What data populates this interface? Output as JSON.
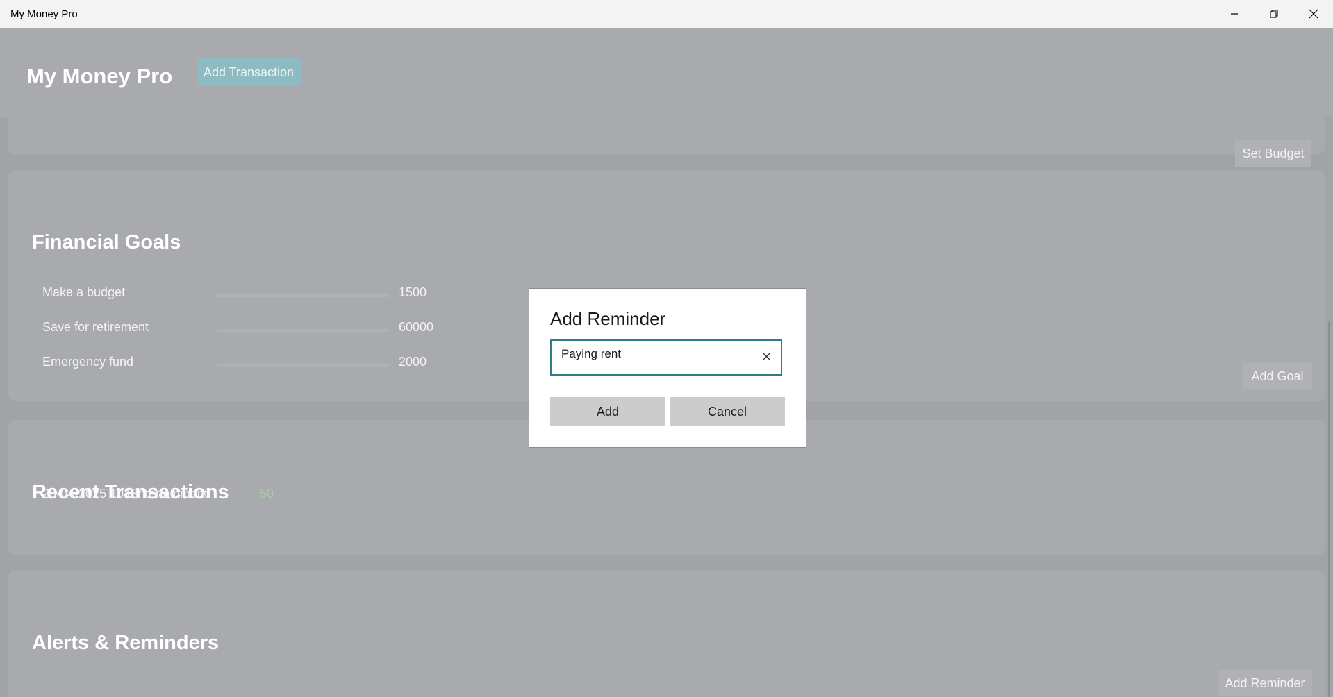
{
  "window": {
    "title": "My Money Pro",
    "controls": {
      "minimize": "minimize-icon",
      "restore": "restore-icon",
      "close": "close-icon"
    }
  },
  "header": {
    "title": "My Money Pro",
    "add_transaction_label": "Add Transaction"
  },
  "budget": {
    "set_budget_label": "Set Budget"
  },
  "goals": {
    "title": "Financial Goals",
    "items": [
      {
        "name": "Make a budget",
        "amount": "1500",
        "progress": 0
      },
      {
        "name": "Save for retirement",
        "amount": "60000",
        "progress": 0
      },
      {
        "name": "Emergency fund",
        "amount": "2000",
        "progress": 0
      }
    ],
    "add_goal_label": "Add Goal"
  },
  "transactions": {
    "title": "Recent Transactions",
    "items": [
      {
        "date": "25-04-2025 10:0",
        "category": "Entertainment",
        "amount": "50"
      }
    ]
  },
  "alerts": {
    "title": "Alerts & Reminders",
    "add_reminder_label": "Add Reminder"
  },
  "dialog": {
    "title": "Add Reminder",
    "input_value": "Paying rent",
    "add_label": "Add",
    "cancel_label": "Cancel"
  },
  "colors": {
    "accent": "#2f7d86",
    "add_transaction_bg": "#8ebac1",
    "income_text": "#a9c9a8"
  }
}
